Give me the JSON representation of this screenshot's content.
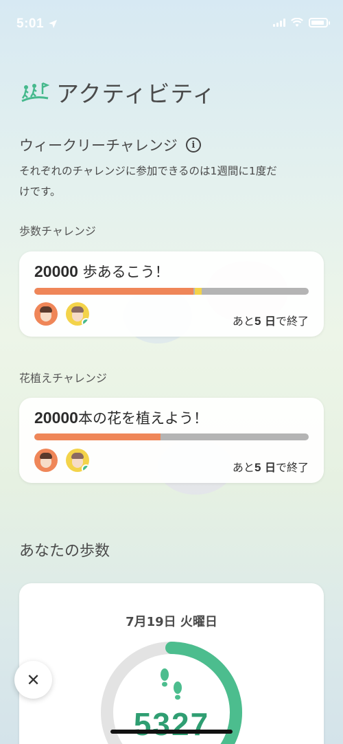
{
  "status_bar": {
    "time": "5:01"
  },
  "header": {
    "title": "アクティビティ",
    "logo_icon": "walking-people-icon"
  },
  "weekly": {
    "title": "ウィークリーチャレンジ",
    "description_line1": "それぞれのチャレンジに参加できるのは1週間に1度だ",
    "description_line2": "けです。"
  },
  "challenges": [
    {
      "label": "歩数チャレンジ",
      "goal_number": "20000",
      "goal_text": " 歩あるこう！",
      "progress": 0.58,
      "marker": 0.585,
      "remain_prefix": "あと",
      "remain_number": "5",
      "remain_unit": " 日",
      "remain_suffix": "で終了"
    },
    {
      "label": "花植えチャレンジ",
      "goal_number": "20000",
      "goal_text": "本の花を植えよう！",
      "progress": 0.46,
      "remain_prefix": "あと",
      "remain_number": "5",
      "remain_unit": " 日",
      "remain_suffix": "で終了"
    }
  ],
  "steps": {
    "title": "あなたの歩数",
    "date": "7月19日 火曜日",
    "value": "5327",
    "ring_progress": 0.55,
    "ring_color": "#4cbd8e"
  },
  "colors": {
    "progress_fill": "#ef8658",
    "progress_marker": "#f3d34a",
    "progress_track": "#b4b4b4"
  }
}
